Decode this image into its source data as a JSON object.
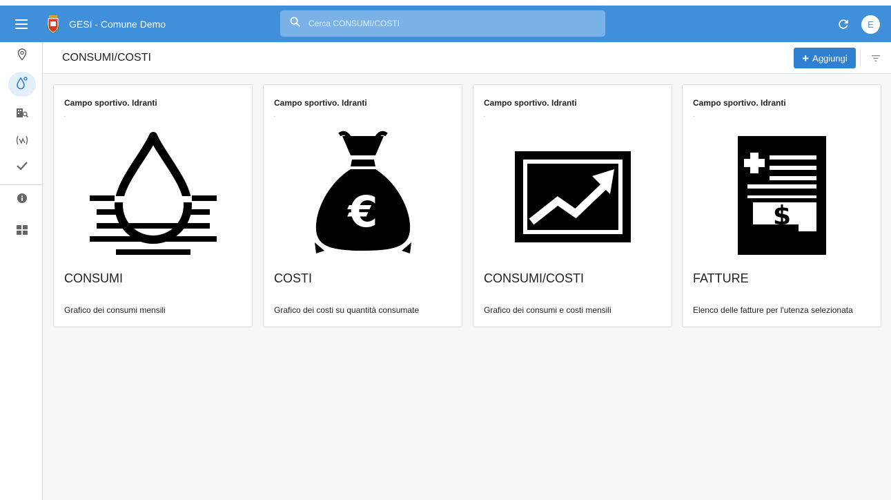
{
  "app": {
    "title": "GESI - Comune Demo",
    "search_placeholder": "Cerca CONSUMI/COSTI",
    "avatar_initial": "E",
    "accent_color": "#3f8fdb"
  },
  "rail": {
    "items": [
      {
        "icon": "location-pin-icon"
      },
      {
        "icon": "water-drop-icon",
        "active": true
      },
      {
        "icon": "building-search-icon"
      },
      {
        "icon": "signal-sensor-icon"
      },
      {
        "icon": "check-icon"
      },
      {
        "icon": "info-icon"
      },
      {
        "icon": "dashboard-grid-icon"
      }
    ]
  },
  "header": {
    "page_title": "CONSUMI/COSTI",
    "add_label": "Aggiungi"
  },
  "cards": [
    {
      "subtitle": "Campo sportivo. Idranti",
      "dot": ".",
      "title": "CONSUMI",
      "description": "Grafico dei consumi mensili",
      "icon": "water-drop-waves-icon"
    },
    {
      "subtitle": "Campo sportivo. Idranti",
      "dot": ".",
      "title": "COSTI",
      "description": "Grafico dei costi su quantità consumate",
      "icon": "euro-money-bag-icon"
    },
    {
      "subtitle": "Campo sportivo. Idranti",
      "dot": ".",
      "title": "CONSUMI/COSTI",
      "description": "Grafico dei consumi e costi mensili",
      "icon": "trend-chart-icon"
    },
    {
      "subtitle": "Campo sportivo. Idranti",
      "dot": ".",
      "title": "FATTURE",
      "description": "Elenco delle fatture per l'utenza selezionata",
      "icon": "invoice-icon"
    }
  ]
}
